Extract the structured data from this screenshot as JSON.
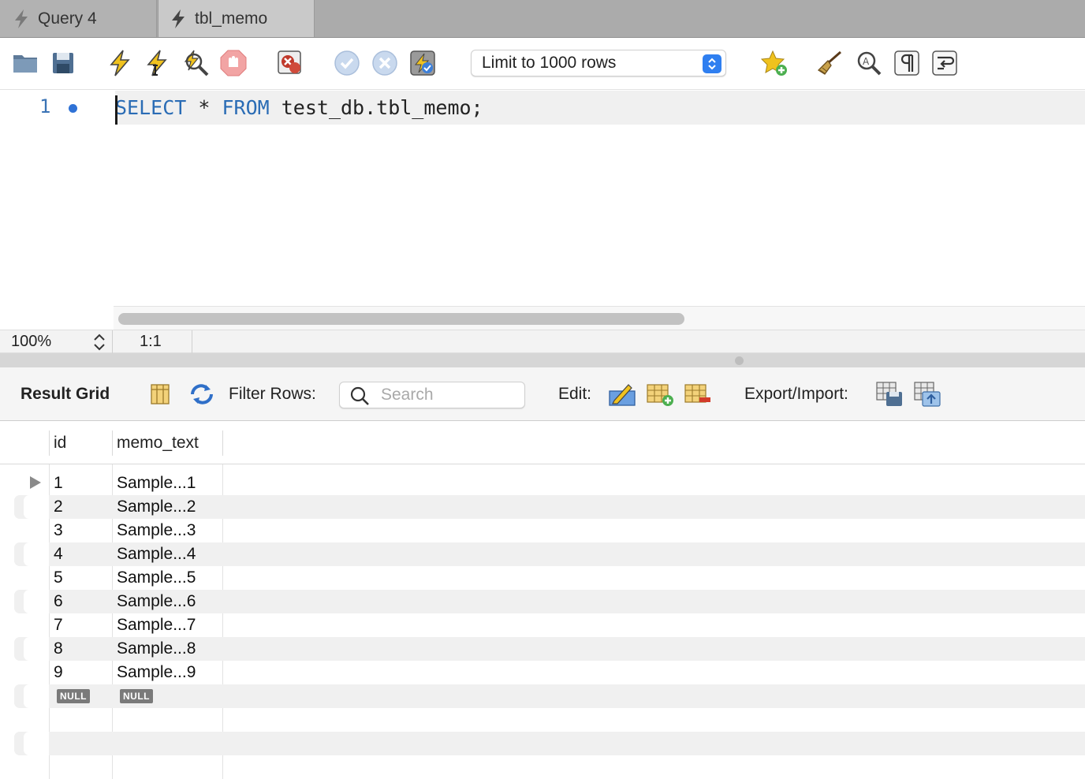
{
  "tabs": [
    {
      "label": "Query 4",
      "active": false
    },
    {
      "label": "tbl_memo",
      "active": true
    }
  ],
  "toolbar": {
    "icons": [
      "open-folder-icon",
      "save-icon",
      "execute-icon",
      "execute-current-icon",
      "explain-icon",
      "stop-icon",
      "toggle-stop-on-error-icon",
      "commit-icon",
      "rollback-icon",
      "autocommit-icon",
      "add-snippet-icon",
      "beautify-icon",
      "find-icon",
      "invisible-chars-icon",
      "wrap-lines-icon"
    ],
    "limit_label": "Limit to 1000 rows"
  },
  "editor": {
    "line_number": "1",
    "code": {
      "kw1": "SELECT",
      "t1": " * ",
      "kw2": "FROM",
      "t2": " test_db.tbl_memo;"
    }
  },
  "status": {
    "zoom": "100%",
    "position": "1:1"
  },
  "results": {
    "title": "Result Grid",
    "filter_label": "Filter Rows:",
    "search_placeholder": "Search",
    "edit_label": "Edit:",
    "export_label": "Export/Import:",
    "columns": [
      "id",
      "memo_text"
    ],
    "rows": [
      {
        "id": "1",
        "memo_text": "Sample...1"
      },
      {
        "id": "2",
        "memo_text": "Sample...2"
      },
      {
        "id": "3",
        "memo_text": "Sample...3"
      },
      {
        "id": "4",
        "memo_text": "Sample...4"
      },
      {
        "id": "5",
        "memo_text": "Sample...5"
      },
      {
        "id": "6",
        "memo_text": "Sample...6"
      },
      {
        "id": "7",
        "memo_text": "Sample...7"
      },
      {
        "id": "8",
        "memo_text": "Sample...8"
      },
      {
        "id": "9",
        "memo_text": "Sample...9"
      }
    ],
    "null_label": "NULL"
  },
  "colors": {
    "keyword": "#2a6cb5",
    "accent": "#2f7ff0"
  }
}
